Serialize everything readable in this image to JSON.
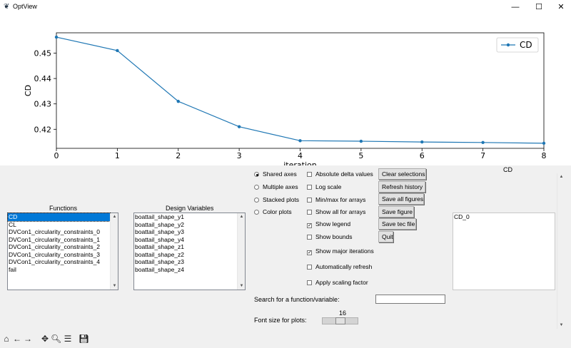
{
  "window": {
    "title": "OptView",
    "minimize_glyph": "—",
    "maximize_glyph": "☐",
    "close_glyph": "✕"
  },
  "chart_data": {
    "type": "line",
    "x": [
      0,
      1,
      2,
      3,
      4,
      5,
      6,
      7,
      8
    ],
    "series": [
      {
        "name": "CD",
        "values": [
          0.4563,
          0.451,
          0.431,
          0.421,
          0.4155,
          0.4153,
          0.415,
          0.4148,
          0.4145
        ],
        "color": "#1f77b4"
      }
    ],
    "xlabel": "iteration",
    "ylabel": "CD",
    "xlim": [
      0,
      8
    ],
    "ylim": [
      0.4125,
      0.458
    ],
    "xticks": [
      "0",
      "1",
      "2",
      "3",
      "4",
      "5",
      "6",
      "7",
      "8"
    ],
    "yticks": [
      "0.42",
      "0.43",
      "0.44",
      "0.45"
    ],
    "ytick_values": [
      0.42,
      0.43,
      0.44,
      0.45
    ],
    "grid": false,
    "legend": "top-right"
  },
  "functions": {
    "header": "Functions",
    "items": [
      "CD",
      "CL",
      "DVCon1_circularity_constraints_0",
      "DVCon1_circularity_constraints_1",
      "DVCon1_circularity_constraints_2",
      "DVCon1_circularity_constraints_3",
      "DVCon1_circularity_constraints_4",
      "fail"
    ],
    "selected": "CD"
  },
  "design_variables": {
    "header": "Design Variables",
    "items": [
      "boattail_shape_y1",
      "boattail_shape_y2",
      "boattail_shape_y3",
      "boattail_shape_y4",
      "boattail_shape_z1",
      "boattail_shape_z2",
      "boattail_shape_z3",
      "boattail_shape_z4"
    ]
  },
  "plot_modes": [
    {
      "label": "Shared axes",
      "selected": true
    },
    {
      "label": "Multiple axes",
      "selected": false
    },
    {
      "label": "Stacked plots",
      "selected": false
    },
    {
      "label": "Color plots",
      "selected": false
    }
  ],
  "options": [
    {
      "label": "Absolute delta values",
      "checked": false
    },
    {
      "label": "Log scale",
      "checked": false
    },
    {
      "label": "Min/max for arrays",
      "checked": false
    },
    {
      "label": "Show all for arrays",
      "checked": false
    },
    {
      "label": "Show legend",
      "checked": true
    },
    {
      "label": "Show bounds",
      "checked": false
    },
    {
      "label": "Show major iterations",
      "checked": true
    },
    {
      "label": "Automatically refresh",
      "checked": false
    },
    {
      "label": "Apply scaling factor",
      "checked": false
    }
  ],
  "buttons": {
    "clear": "Clear selections",
    "refresh": "Refresh history",
    "save_all": "Save all figures",
    "save_figure": "Save figure",
    "save_tec": "Save tec file",
    "quit": "Quit"
  },
  "right_panel": {
    "header": "CD",
    "items": [
      "CD_0"
    ]
  },
  "search": {
    "label": "Search for a function/variable:",
    "value": ""
  },
  "font_size": {
    "label": "Font size for plots:",
    "value": "16",
    "level": 0.5
  },
  "toolbar_icons": [
    "home-icon",
    "back-icon",
    "forward-icon",
    "pan-icon",
    "zoom-icon",
    "configure-icon",
    "save-icon"
  ],
  "toolbar_glyphs": [
    "⌂",
    "←",
    "→",
    "✥",
    "🔍︎",
    "☰",
    "💾︎"
  ]
}
